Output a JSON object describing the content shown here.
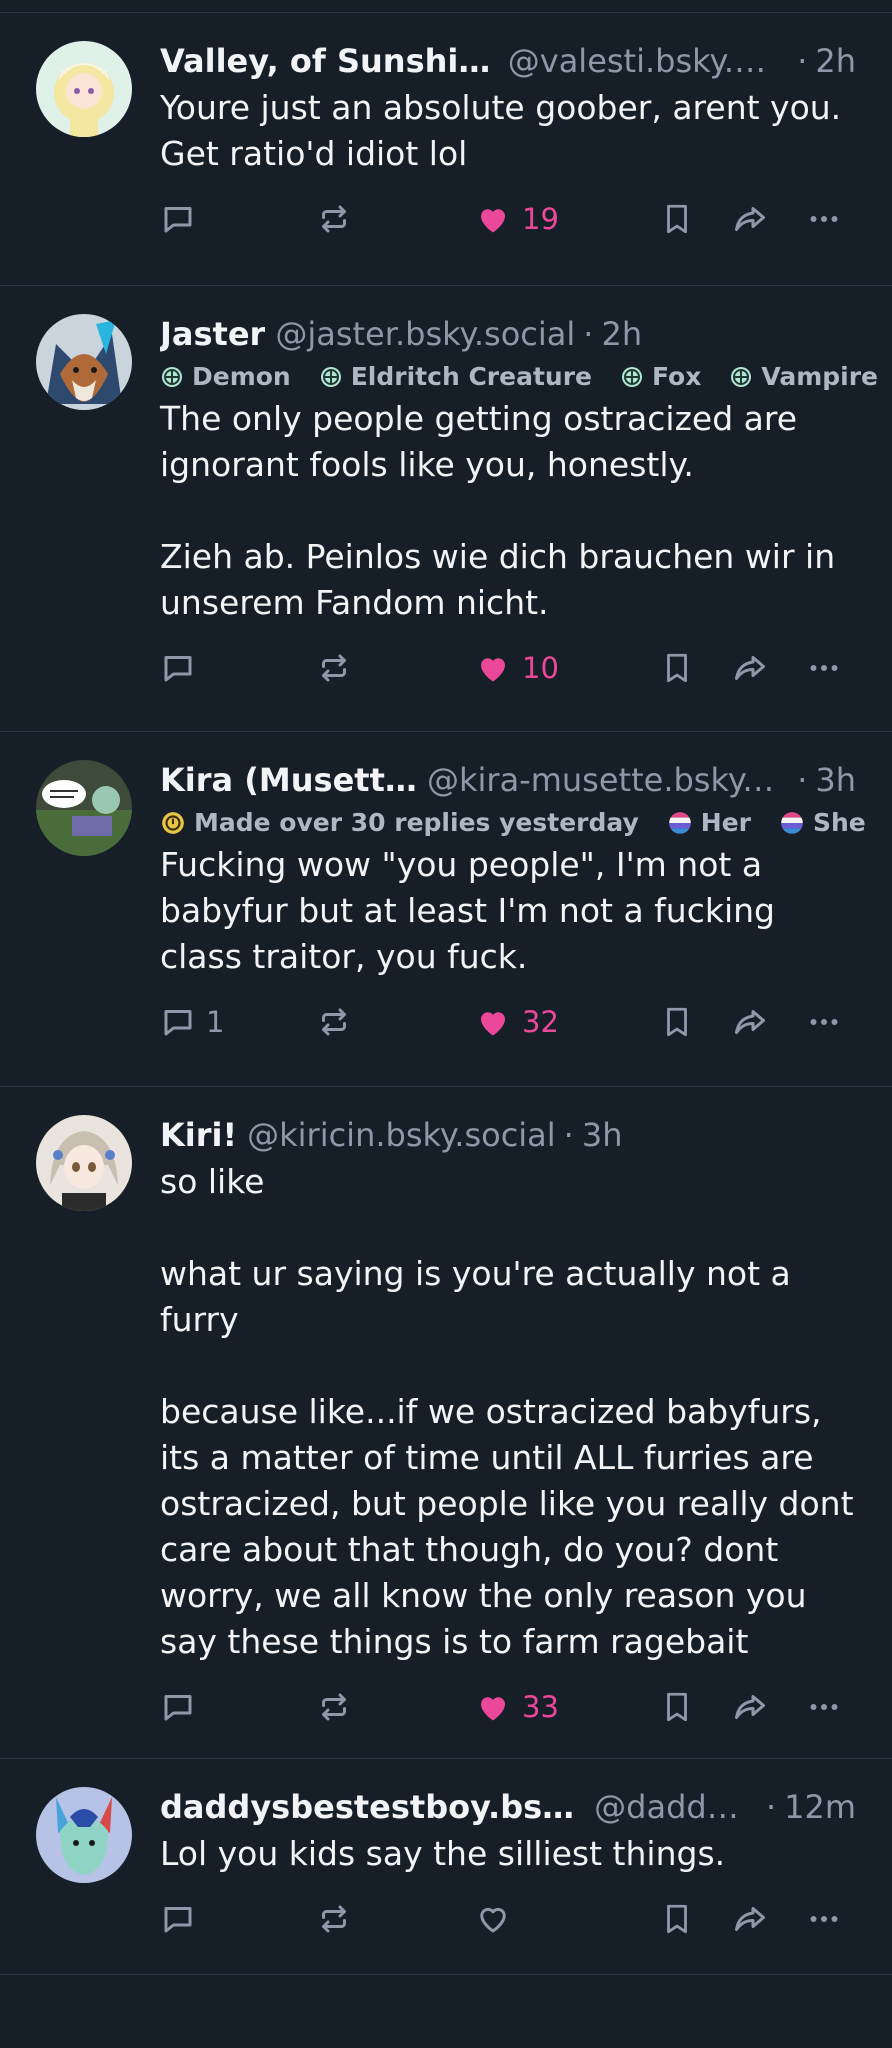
{
  "posts": [
    {
      "name": "Valley, of Sunshine",
      "handle": "@valesti.bsky.s...",
      "time": "2h",
      "labels": [],
      "text": "Youre just an absolute goober, arent you. Get ratio'd idiot lol",
      "reply_count": "",
      "like_count": "19",
      "liked": true
    },
    {
      "name": "Jaster",
      "handle": "@jaster.bsky.social",
      "time": "2h",
      "labels": [
        "Demon",
        "Eldritch Creature",
        "Fox",
        "Vampire"
      ],
      "text": "The only people getting ostracized are ignorant fools like you, honestly.\n\nZieh ab. Peinlos wie dich brauchen wir in unserem Fandom nicht.",
      "reply_count": "",
      "like_count": "10",
      "liked": true
    },
    {
      "name": "Kira (Musette)",
      "handle": "@kira-musette.bsky....",
      "time": "3h",
      "labels": [
        "Made over 30 replies yesterday",
        "Her",
        "She"
      ],
      "text": "Fucking wow \"you people\", I'm not a babyfur but at least I'm not a fucking class traitor, you fuck.",
      "reply_count": "1",
      "like_count": "32",
      "liked": true
    },
    {
      "name": "Kiri!",
      "handle": "@kiricin.bsky.social",
      "time": "3h",
      "labels": [],
      "text": "so like\n\nwhat ur saying is you're actually not a furry\n\nbecause like...if we ostracized babyfurs, its a matter of time until ALL furries are ostracized, but people like you really dont care about that though, do you? dont worry, we all know the only reason you say these things is to farm ragebait",
      "reply_count": "",
      "like_count": "33",
      "liked": true
    },
    {
      "name": "daddysbestestboy.bsk...",
      "handle": "@daddy...",
      "time": "12m",
      "labels": [],
      "text": "Lol you kids say the silliest things.",
      "reply_count": "",
      "like_count": "",
      "liked": false
    }
  ],
  "separator": "·",
  "colors": {
    "background": "#161e27",
    "divider": "#2a3441",
    "muted": "#8d99a8",
    "like": "#ec4899"
  },
  "icons": [
    "reply-icon",
    "repost-icon",
    "heart-icon",
    "bookmark-icon",
    "share-icon",
    "more-icon",
    "label-globe-icon",
    "badge-icon"
  ]
}
